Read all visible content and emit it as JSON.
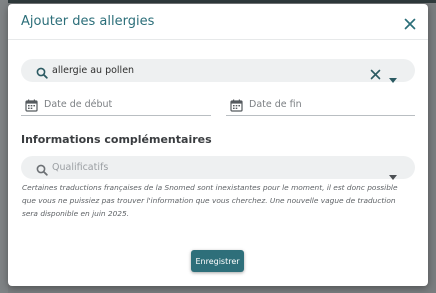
{
  "modal": {
    "title": "Ajouter des allergies",
    "search": {
      "value": "allergie au pollen",
      "icon": "search-icon"
    },
    "date_start": {
      "placeholder": "Date de début"
    },
    "date_end": {
      "placeholder": "Date de fin"
    },
    "section_title": "Informations complémentaires",
    "qualifiers": {
      "placeholder": "Qualificatifs"
    },
    "note": "Certaines traductions françaises de la Snomed sont inexistantes pour le moment, il est donc possible que vous ne puissiez pas trouver l'information que vous cherchez. Une nouvelle vague de traduction sera disponible en juin 2025.",
    "save_label": "Enregistrer"
  },
  "colors": {
    "accent": "#2e6f7a",
    "title": "#2b6e79",
    "field_bg": "#eef0f1",
    "overlay": "#7a7d7f"
  }
}
